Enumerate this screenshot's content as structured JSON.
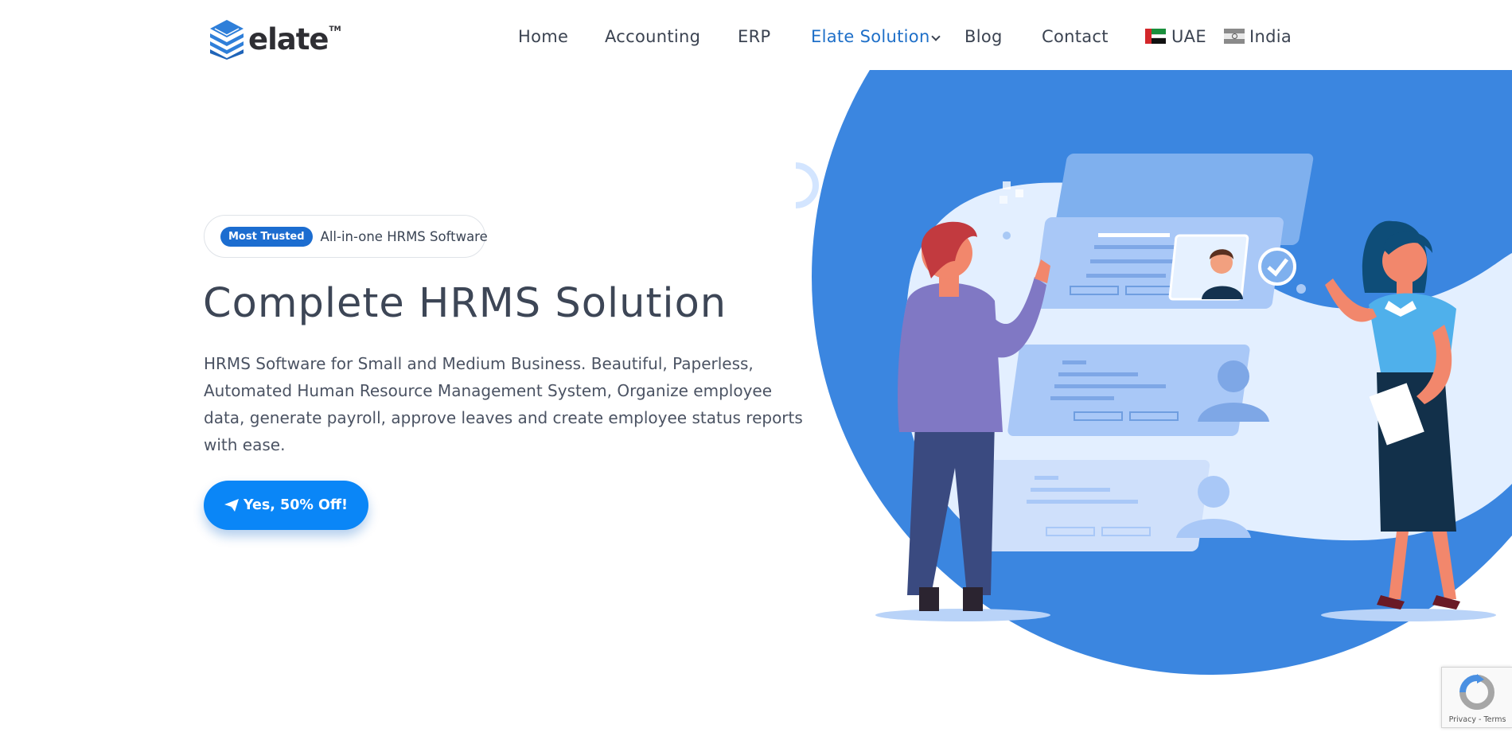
{
  "logo": {
    "text": "elate",
    "tm": "TM"
  },
  "nav": {
    "items": [
      "Home",
      "Accounting",
      "ERP",
      "Elate Solution",
      "Blog",
      "Contact"
    ],
    "active": "Elate Solution",
    "regions": [
      {
        "label": "UAE",
        "flag": "uae-flag-icon"
      },
      {
        "label": "India",
        "flag": "india-flag-icon"
      }
    ]
  },
  "hero": {
    "badge_tag": "Most Trusted",
    "badge_text": "All-in-one HRMS Software",
    "title": "Complete HRMS Solution",
    "description": "HRMS Software for Small and Medium Business. Beautiful, Paperless, Automated Human Resource Management System, Organize employee data, generate payroll, approve leaves and create employee status reports with ease.",
    "cta_label": "Yes, 50% Off!",
    "cta_icon": "paper-plane-icon"
  },
  "recaptcha": {
    "links": "Privacy - Terms"
  },
  "colors": {
    "brand_blue": "#1e6fc8",
    "cta_blue": "#0a86f7",
    "illustration_blue": "#3b86e0",
    "text": "#3d4656"
  }
}
